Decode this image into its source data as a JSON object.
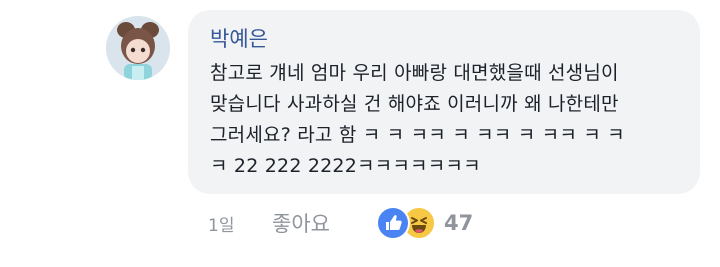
{
  "comment": {
    "author": "박예은",
    "lines": [
      "참고로 걔네 엄마 우리 아빠랑 대면했을때 선생님이",
      "맞습니다 사과하실 건 해야죠 이러니까 왜 나한테만",
      "그러세요? 라고 함 ㅋ ㅋ ㅋㅋ ㅋ ㅋㅋ ㅋ ㅋㅋ ㅋ ㅋ",
      "ㅋ 22 222 2222ㅋㅋㅋㅋㅋㅋㅋ"
    ]
  },
  "footer": {
    "timestamp": "1일",
    "like_label": "좋아요",
    "reactions": [
      "like-icon",
      "haha-icon"
    ],
    "reaction_count": "47"
  },
  "colors": {
    "author": "#365899",
    "bubble": "#f2f3f5",
    "like_reaction": "#4a83f2",
    "haha_reaction": "#f7c843",
    "meta_text": "#90949c"
  }
}
